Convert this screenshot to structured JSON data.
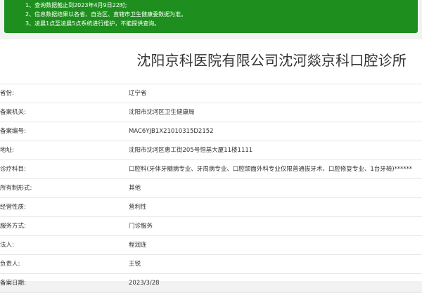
{
  "notice": {
    "lines": [
      "1、查询数据截止到2023年4月9日22时;",
      "2、信息数据结果以各省、自治区、直辖市卫生健康委数据为准。",
      "3、凌晨1点至凌晨5点系统进行维护，不能提供查询。"
    ]
  },
  "record": {
    "title": "沈阳京科医院有限公司沈河燚京科口腔诊所",
    "rows": [
      {
        "label": "省份:",
        "value": "辽宁省"
      },
      {
        "label": "备案机关:",
        "value": "沈阳市沈河区卫生健康局"
      },
      {
        "label": "备案编号:",
        "value": "MAC6YJB1X21010315D2152"
      },
      {
        "label": "地址:",
        "value": "沈阳市沈河区惠工街205号恒基大厦11楼1111"
      },
      {
        "label": "诊疗科目:",
        "value": "口腔科(牙体牙髓病专业、牙周病专业、口腔颌面外科专业仅限普通拔牙术、口腔修复专业、1台牙椅)******"
      },
      {
        "label": "所有制形式:",
        "value": "其他"
      },
      {
        "label": "经营性质:",
        "value": "营利性"
      },
      {
        "label": "服务方式:",
        "value": "门诊服务"
      },
      {
        "label": "法人:",
        "value": "程润连"
      },
      {
        "label": "负责人:",
        "value": "王锐"
      },
      {
        "label": "备案日期:",
        "value": "2023/3/28"
      }
    ]
  }
}
